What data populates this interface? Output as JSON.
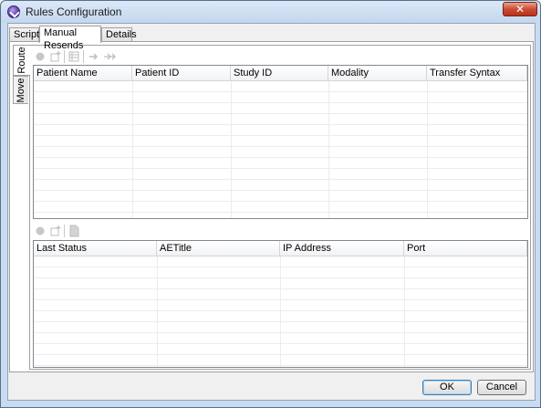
{
  "window": {
    "title": "Rules Configuration",
    "close_glyph": "✕"
  },
  "tabs": [
    {
      "label": "Script"
    },
    {
      "label": "Manual Resends"
    },
    {
      "label": "Details"
    }
  ],
  "side_tabs": [
    {
      "label": "Route"
    },
    {
      "label": "Move"
    }
  ],
  "top_toolbar": {
    "icons": [
      "circle-icon",
      "add-item-icon",
      "grid-icon",
      "arrow-right-icon",
      "double-arrow-right-icon"
    ]
  },
  "patients_table": {
    "columns": [
      "Patient Name",
      "Patient ID",
      "Study ID",
      "Modality",
      "Transfer Syntax"
    ],
    "rows": []
  },
  "bottom_toolbar": {
    "icons": [
      "circle-icon",
      "add-item-icon",
      "document-icon"
    ]
  },
  "status_table": {
    "columns": [
      "Last Status",
      "AETitle",
      "IP Address",
      "Port"
    ],
    "rows": []
  },
  "buttons": {
    "ok": "OK",
    "cancel": "Cancel"
  },
  "colors": {
    "titlebar": "#c4d7ee",
    "close": "#cc4b35",
    "client": "#f0f0f0"
  }
}
